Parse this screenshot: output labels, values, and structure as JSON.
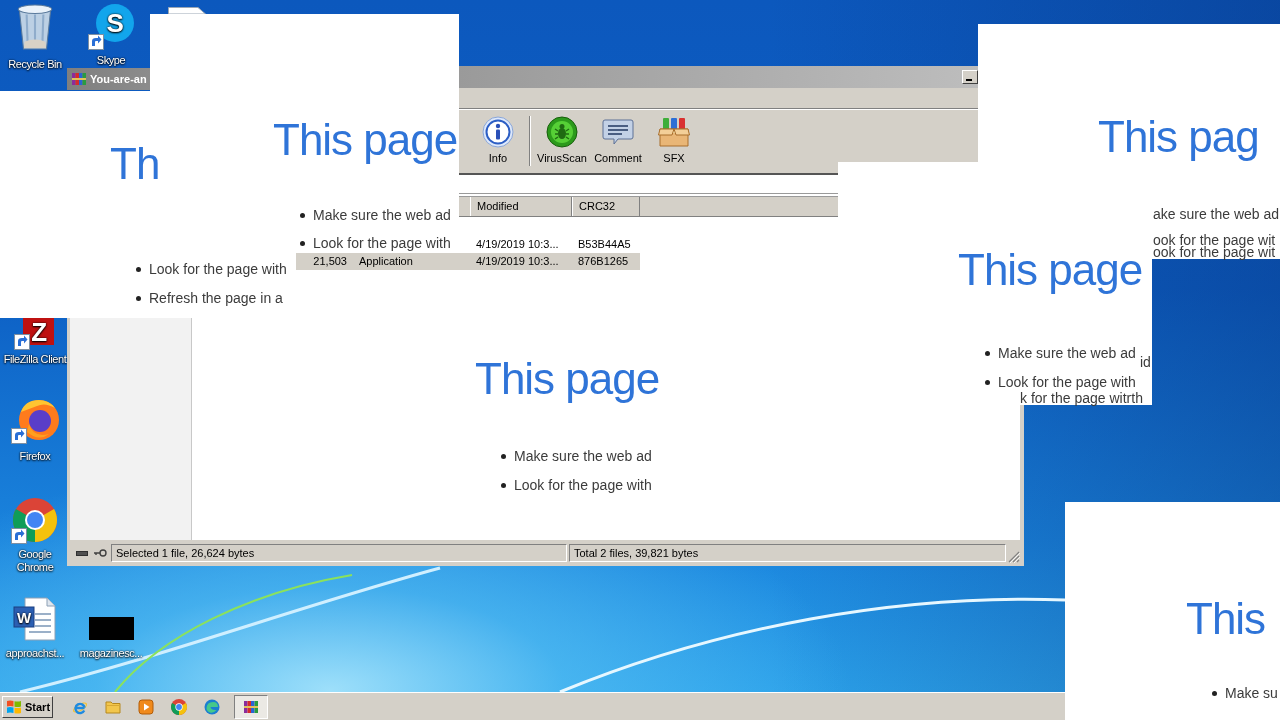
{
  "desktop": {
    "icons": [
      {
        "kind": "recycle-bin",
        "label": "Recycle Bin"
      },
      {
        "kind": "skype",
        "label": "Skype",
        "glyph": "S"
      },
      {
        "kind": "document"
      },
      {
        "kind": "filezilla",
        "label": "FileZilla Client",
        "glyph": "Z"
      },
      {
        "kind": "firefox",
        "label": "Firefox"
      },
      {
        "kind": "chrome",
        "label": "Google Chrome"
      },
      {
        "kind": "word-document",
        "label": "approachst...",
        "glyph": "W"
      },
      {
        "kind": "image-thumbnail",
        "label": "magazinesc..."
      }
    ]
  },
  "archive_window": {
    "title": "You-are-an",
    "toolbar": [
      {
        "kind": "info",
        "label": "Info",
        "separator_before": false
      },
      {
        "kind": "virus-scan",
        "label": "VirusScan",
        "separator_before": true
      },
      {
        "kind": "comment",
        "label": "Comment",
        "separator_before": false
      },
      {
        "kind": "sfx",
        "label": "SFX",
        "separator_before": false
      }
    ],
    "columns": [
      "Modified",
      "CRC32"
    ],
    "rows": [
      {
        "selected": false,
        "cells": [
          "4/19/2019 10:3...",
          "B53B44A5"
        ]
      },
      {
        "selected": true,
        "cells": [
          "21,503",
          "Application",
          "4/19/2019 10:3...",
          "876B1265"
        ]
      }
    ],
    "content": {
      "heading": "This page",
      "items": [
        "Make sure the web ad",
        "Look for the page with"
      ]
    },
    "status": [
      "Selected 1 file, 26,624 bytes",
      "Total 2 files, 39,821 bytes"
    ]
  },
  "page_fragments": [
    {
      "heading": "Th",
      "items": [
        "Look for the page with",
        "Refresh the page in a"
      ]
    },
    {
      "heading": "This page",
      "items": [
        "Make sure the web ad",
        "Look for the page with"
      ]
    },
    {
      "heading": "This pag",
      "fragments": [
        "ake sure the web ad",
        "ook for the page wit",
        "ook for the page wit"
      ]
    },
    {
      "heading": "This page",
      "items": [
        "Make sure the web ad",
        "Look for the page with"
      ],
      "fragments": [
        "id",
        "k for the page witrth"
      ]
    },
    {
      "heading": "This",
      "items": [
        "Make su"
      ]
    }
  ],
  "taskbar": {
    "start": "Start",
    "apps": [
      {
        "kind": "internet-explorer",
        "active": false
      },
      {
        "kind": "folder",
        "active": false
      },
      {
        "kind": "media-player",
        "active": false
      },
      {
        "kind": "chrome",
        "active": false
      },
      {
        "kind": "edge",
        "active": false
      },
      {
        "kind": "archiver",
        "active": true
      }
    ]
  }
}
